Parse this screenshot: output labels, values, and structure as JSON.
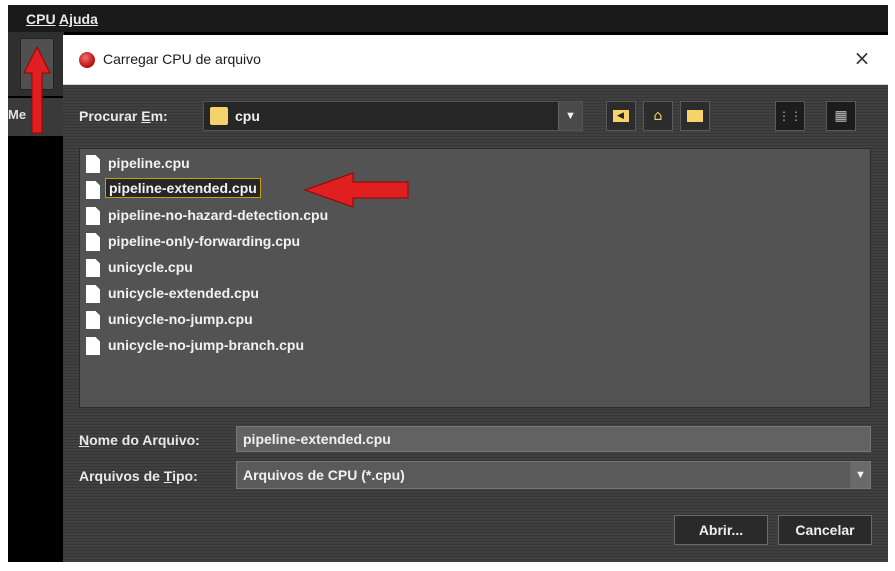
{
  "menubar": {
    "items": [
      "CPU",
      "Ajuda"
    ]
  },
  "background_tab": {
    "label": "Me"
  },
  "dialog": {
    "title": "Carregar CPU de arquivo",
    "close": "×",
    "look_in_label_pre": "Procurar ",
    "look_in_label_key": "E",
    "look_in_label_post": "m:",
    "look_in_value": "cpu",
    "toolbar_icons": [
      "up-folder-icon",
      "home-icon",
      "new-folder-icon",
      "list-view-icon",
      "details-view-icon"
    ],
    "files": [
      "pipeline.cpu",
      "pipeline-extended.cpu",
      "pipeline-no-hazard-detection.cpu",
      "pipeline-only-forwarding.cpu",
      "unicycle.cpu",
      "unicycle-extended.cpu",
      "unicycle-no-jump.cpu",
      "unicycle-no-jump-branch.cpu"
    ],
    "selected_file": "pipeline-extended.cpu",
    "filename_label_key": "N",
    "filename_label_rest": "ome do Arquivo:",
    "filename_value": "pipeline-extended.cpu",
    "filetype_label_pre": "Arquivos de ",
    "filetype_label_key": "T",
    "filetype_label_post": "ipo:",
    "filetype_value": "Arquivos de CPU (*.cpu)",
    "open_button": "Abrir...",
    "cancel_button": "Cancelar"
  },
  "colors": {
    "dialog_bg": "#3c3c3c",
    "list_bg": "#535353",
    "selection_outline": "#c8a000",
    "annotation_arrow": "#e02020"
  }
}
